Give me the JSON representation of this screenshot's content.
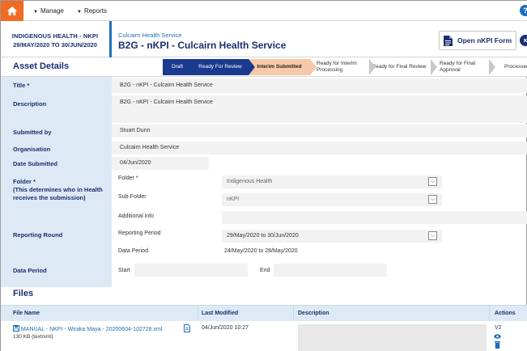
{
  "nav": {
    "manage_label": "Manage",
    "reports_label": "Reports",
    "help_label": "?"
  },
  "header": {
    "context_line1": "Indigenous Health - nKPI",
    "context_line2": "29/May/2020 to 30/Jun/2020",
    "subtitle": "Culcairn Health Service",
    "title": "B2G - nKPI - Culcairn Health Service",
    "open_button_label": "Open nKPI Form",
    "close_label": "×"
  },
  "asset_details": {
    "heading": "Asset Details"
  },
  "workflow": {
    "steps": [
      {
        "label": "Draft",
        "state": "done"
      },
      {
        "label": "Ready For Review",
        "state": "done"
      },
      {
        "label": "Interim Submitted",
        "state": "current"
      },
      {
        "label": "Ready for Interim Processing",
        "state": "pending"
      },
      {
        "label": "Ready for Final Review",
        "state": "pending"
      },
      {
        "label": "Ready for Final Approval",
        "state": "pending"
      },
      {
        "label": "Processed",
        "state": "pending"
      }
    ]
  },
  "fields": {
    "title_label": "Title",
    "title_value": "B2G - nKPI - Culcairn Health Service",
    "description_label": "Description",
    "description_value": "B2G - nKPI - Culcairn Health Service",
    "submitted_by_label": "Submitted by",
    "submitted_by_value": "Stuart Dunn",
    "organisation_label": "Organisation",
    "organisation_value": "Culcairn Health Service",
    "date_submitted_label": "Date Submitted",
    "date_submitted_value": "04/Jun/2020",
    "folder_label": "Folder",
    "folder_note": "(This determines who in Health receives the submission)",
    "folder_sub_label": "Folder",
    "folder_value": "Indigenous Health",
    "subfolder_label": "Sub-Folder",
    "subfolder_value": "nKPI",
    "additional_info_label": "Additional info",
    "additional_info_value": "",
    "reporting_round_label": "Reporting Round",
    "reporting_period_label": "Reporting Period",
    "reporting_period_value": "29/May/2020 to 30/Jun/2020",
    "data_period_sub_label": "Data Period",
    "data_period_sub_value": "24/May/2020 to 28/May/2020",
    "data_period_label": "Data Period",
    "start_label": "Start",
    "start_value": "",
    "end_label": "End",
    "end_value": "",
    "required_mark": "*"
  },
  "files": {
    "heading": "Files",
    "columns": [
      "File Name",
      "Last Modified",
      "Description",
      "Actions"
    ],
    "rows": [
      {
        "name": "MANUAL - NKPI - Wiraka Maya - 20200604-102728.xml",
        "size": "130 KB (text/xml)",
        "last_modified": "04/Jun/2020 10:27",
        "description": "",
        "version": "V2"
      }
    ]
  },
  "colors": {
    "accent": "#f26b24",
    "navy": "#1a2f6e",
    "step_done": "#1a3a8f",
    "step_current": "#f7c9a8",
    "label_bg": "#dde9f5"
  }
}
